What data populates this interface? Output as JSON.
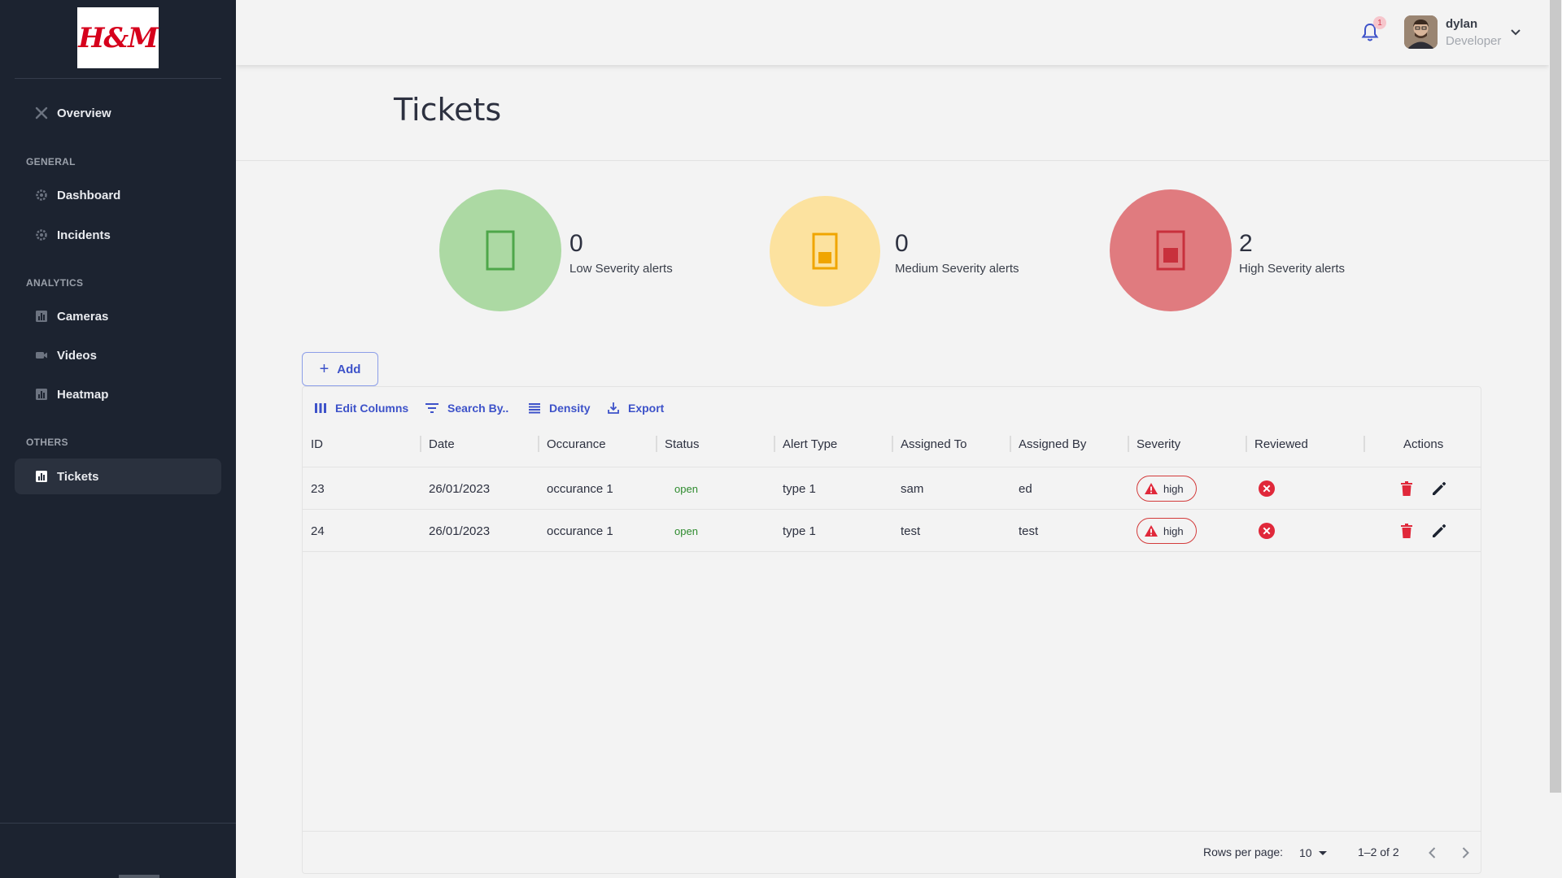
{
  "brand": {
    "logo_text": "H&M"
  },
  "sidebar": {
    "overview": "Overview",
    "sections": [
      {
        "title": "GENERAL",
        "items": [
          "Dashboard",
          "Incidents"
        ]
      },
      {
        "title": "ANALYTICS",
        "items": [
          "Cameras",
          "Videos",
          "Heatmap"
        ]
      },
      {
        "title": "OTHERS",
        "items": [
          "Tickets"
        ]
      }
    ],
    "active_item": "Tickets"
  },
  "header": {
    "notification_count": "1",
    "user_name": "dylan",
    "user_role": "Developer"
  },
  "page": {
    "title": "Tickets"
  },
  "stats": [
    {
      "count": "0",
      "label": "Low Severity alerts",
      "color": "#acd9a3",
      "icon_color": "#4ea64a"
    },
    {
      "count": "0",
      "label": "Medium Severity alerts",
      "color": "#fce29f",
      "icon_color": "#f0a500"
    },
    {
      "count": "2",
      "label": "High Severity alerts",
      "color": "#e07b7f",
      "icon_color": "#c8303c"
    }
  ],
  "actions": {
    "add_label": "Add"
  },
  "toolbar": {
    "edit_columns": "Edit Columns",
    "search_by": "Search By..",
    "density": "Density",
    "export": "Export"
  },
  "table": {
    "columns": [
      "ID",
      "Date",
      "Occurance",
      "Status",
      "Alert Type",
      "Assigned To",
      "Assigned By",
      "Severity",
      "Reviewed",
      "Actions"
    ],
    "rows": [
      {
        "id": "23",
        "date": "26/01/2023",
        "occurance": "occurance 1",
        "status": "open",
        "alert_type": "type 1",
        "assigned_to": "sam",
        "assigned_by": "ed",
        "severity": "high"
      },
      {
        "id": "24",
        "date": "26/01/2023",
        "occurance": "occurance 1",
        "status": "open",
        "alert_type": "type 1",
        "assigned_to": "test",
        "assigned_by": "test",
        "severity": "high"
      }
    ]
  },
  "pagination": {
    "rows_per_page_label": "Rows per page:",
    "rows_per_page": "10",
    "range": "1–2 of 2"
  },
  "colors": {
    "sidebar_bg": "#1c2330",
    "accent": "#3d52c9",
    "danger": "#e0283a",
    "status_open": "#2e8b2e"
  }
}
